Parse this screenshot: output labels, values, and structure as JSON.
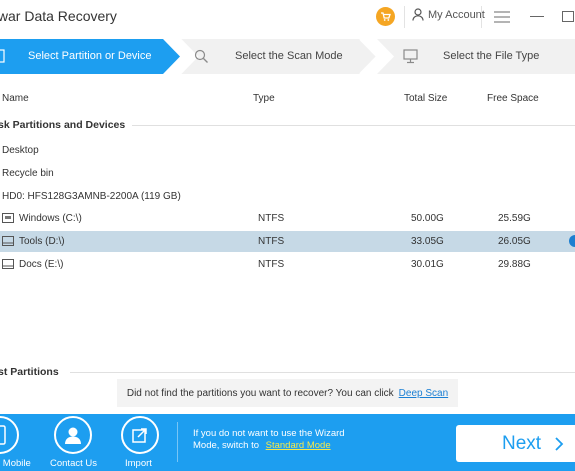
{
  "window": {
    "title": "twar Data Recovery",
    "account_label": "My Account",
    "accent": "#1d9ef0",
    "cart_color": "#f5a623"
  },
  "steps": [
    {
      "label": "Select Partition or Device",
      "active": true,
      "icon": "partition-icon"
    },
    {
      "label": "Select the Scan Mode",
      "active": false,
      "icon": "search-icon"
    },
    {
      "label": "Select the File Type",
      "active": false,
      "icon": "monitor-icon"
    }
  ],
  "columns": {
    "name": "Name",
    "type": "Type",
    "total": "Total Size",
    "free": "Free Space"
  },
  "sections": {
    "disks": "sk Partitions and Devices",
    "lost": "st Partitions"
  },
  "locations": [
    {
      "name": "Desktop"
    },
    {
      "name": "Recycle bin"
    }
  ],
  "disk": {
    "name": "HD0: HFS128G3AMNB-2200A (119 GB)"
  },
  "partitions": [
    {
      "name": "Windows (C:\\)",
      "type": "NTFS",
      "total": "50.00G",
      "free": "25.59G",
      "selected": false,
      "icon": "os-drive-icon"
    },
    {
      "name": "Tools (D:\\)",
      "type": "NTFS",
      "total": "33.05G",
      "free": "26.05G",
      "selected": true,
      "icon": "drive-icon"
    },
    {
      "name": "Docs (E:\\)",
      "type": "NTFS",
      "total": "30.01G",
      "free": "29.88G",
      "selected": false,
      "icon": "drive-icon"
    }
  ],
  "notice": {
    "text": "Did not find the partitions you want to recover? You can click",
    "link": "Deep Scan"
  },
  "footer": {
    "buttons": [
      {
        "label": "r Mobile",
        "icon": "mobile-icon"
      },
      {
        "label": "Contact Us",
        "icon": "user-icon"
      },
      {
        "label": "Import",
        "icon": "import-icon"
      }
    ],
    "wizard_line1": "If you do not want to use the Wizard",
    "wizard_line2": "Mode, switch to",
    "wizard_link": "Standard Mode",
    "next_label": "Next"
  }
}
